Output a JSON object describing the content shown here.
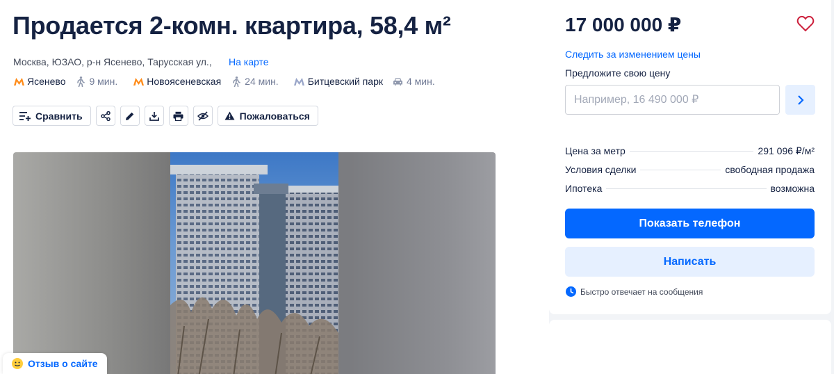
{
  "listing": {
    "title": "Продается 2-комн. квартира, 58,4 м²",
    "address": "Москва, ЮЗАО, р-н Ясенево, Тарусская ул.,",
    "map_link": "На карте",
    "metro": [
      {
        "station": "Ясенево",
        "time": "9 мин.",
        "line_color": "#ff8c1a",
        "transport": "walk-icon"
      },
      {
        "station": "Новоясеневская",
        "time": "24 мин.",
        "line_color": "#ff8c1a",
        "transport": "walk-icon"
      },
      {
        "station": "Битцевский парк",
        "time": "4 мин.",
        "line_color": "#9aa6c9",
        "transport": "car-icon"
      }
    ]
  },
  "actions": {
    "compare": "Сравнить",
    "complain": "Пожаловаться",
    "icons": [
      "compare-icon",
      "share-icon",
      "edit-icon",
      "download-icon",
      "print-icon",
      "hide-icon",
      "warning-icon"
    ]
  },
  "feedback": {
    "label": "Отзыв о сайте"
  },
  "sidebar": {
    "price": "17 000 000 ₽",
    "watch_price": "Следить за изменением цены",
    "offer_label": "Предложите свою цену",
    "offer_placeholder": "Например, 16 490 000 ₽",
    "facts": [
      {
        "key": "Цена за метр",
        "value": "291 096 ₽/м²"
      },
      {
        "key": "Условия сделки",
        "value": "свободная продажа"
      },
      {
        "key": "Ипотека",
        "value": "возможна"
      }
    ],
    "show_phone": "Показать телефон",
    "write": "Написать",
    "response_note": "Быстро отвечает на сообщения"
  },
  "colors": {
    "accent": "#0468ff",
    "accent_light": "#e6f0ff",
    "text": "#152242",
    "favorite": "#cc1f3b"
  }
}
